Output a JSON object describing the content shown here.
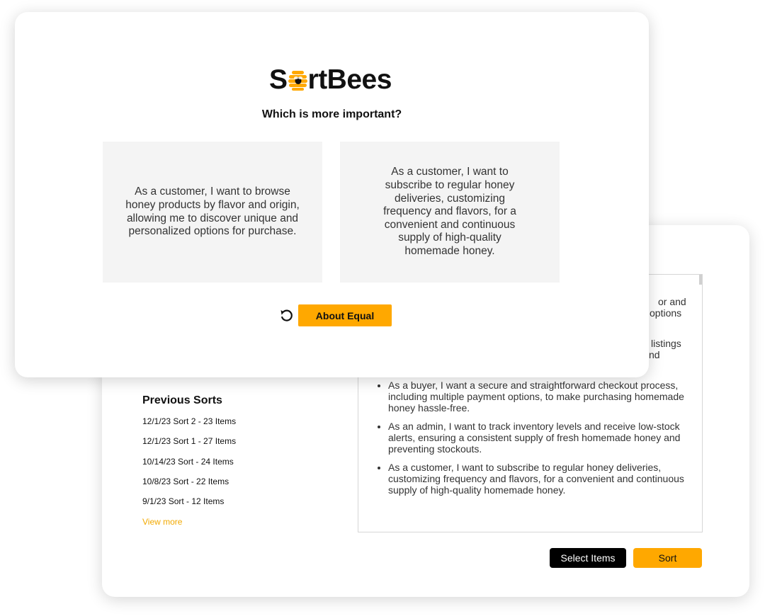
{
  "brand": {
    "name_prefix": "S",
    "name_suffix": "rtBees",
    "accent_color": "#ffa800",
    "link_color": "#f2a900"
  },
  "comparison": {
    "question": "Which is more important?",
    "option_left": "As a customer, I want to browse honey products by flavor and origin, allowing me to discover unique and personalized options for purchase.",
    "option_right": "As a customer, I want to subscribe to regular honey deliveries, customizing frequency and flavors, for a convenient and continuous supply of high-quality homemade honey.",
    "equal_label": "About Equal",
    "undo_icon": "undo-icon"
  },
  "stories": {
    "partial_lines": [
      "or and",
      "options",
      "listings",
      "nd"
    ],
    "items": [
      "As a buyer, I want a secure and straightforward checkout process, including multiple payment options, to make purchasing homemade honey hassle-free.",
      "As an admin, I want to track inventory levels and receive low-stock alerts, ensuring a consistent supply of fresh homemade honey and preventing stockouts.",
      "As a customer, I want to subscribe to regular honey deliveries, customizing frequency and flavors, for a convenient and continuous supply of high-quality homemade honey."
    ]
  },
  "previous_sorts": {
    "title": "Previous Sorts",
    "items": [
      "12/1/23 Sort 2 - 23 Items",
      "12/1/23 Sort 1 - 27 Items",
      "10/14/23 Sort - 24 Items",
      "10/8/23 Sort - 22 Items",
      "9/1/23 Sort - 12 Items"
    ],
    "view_more": "View more"
  },
  "actions": {
    "select_items": "Select Items",
    "sort": "Sort"
  }
}
